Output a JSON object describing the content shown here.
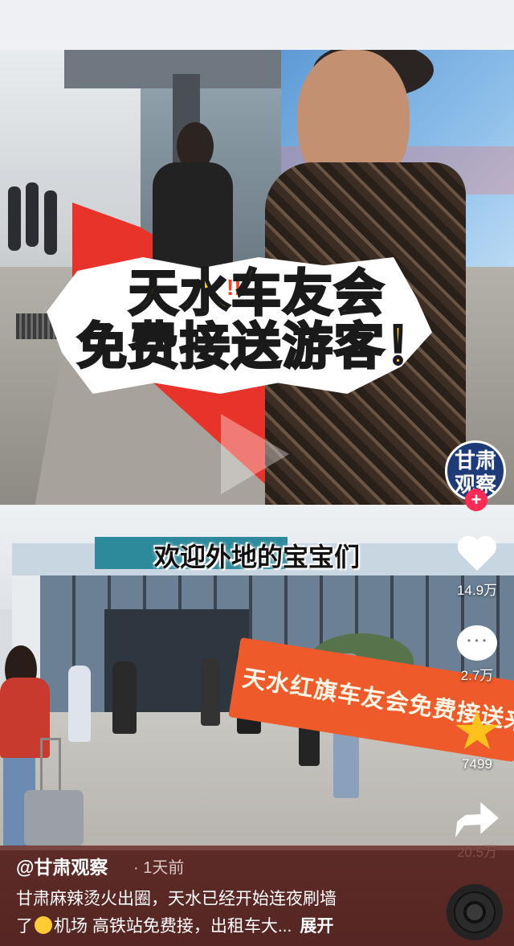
{
  "video_top": {
    "headline_line1": "天水车友会",
    "headline_line2": "免费接送游客！",
    "exclaim": "!!!"
  },
  "video_bottom": {
    "subtitle": "欢迎外地的宝宝们",
    "banner_text": "天水红旗车友会免费接送来天水吃麻辣烫"
  },
  "account": {
    "avatar_line1": "甘肃",
    "avatar_line2": "观察",
    "follow_symbol": "+"
  },
  "actions": {
    "likes": "14.9万",
    "comments": "2.7万",
    "favorites": "7499",
    "shares": "20.5万"
  },
  "post": {
    "author": "@甘肃观察",
    "time": "· 1天前",
    "caption_line1": "甘肃麻辣烫火出圈，天水已经开始连夜刷墙",
    "caption_line2_a": "了",
    "caption_line2_b": "机场 高铁站免费接，出租车大...",
    "expand_label": "展开"
  },
  "icons": [
    "heart-icon",
    "comment-icon",
    "star-icon",
    "share-icon",
    "music-disc-icon",
    "play-icon",
    "emoji-grin-icon"
  ],
  "colors": {
    "like": "#ffffff",
    "favorite": "#ffc21a",
    "follow": "#fe2c55",
    "headline": "#ffd61c"
  }
}
